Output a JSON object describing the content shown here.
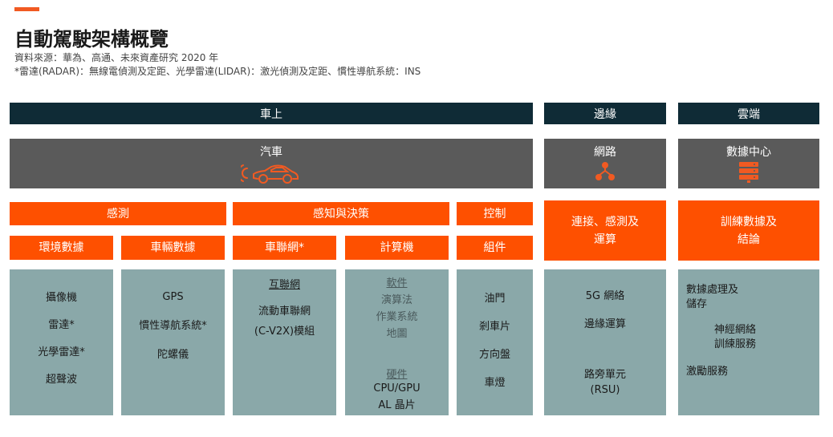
{
  "header": {
    "title": "自動駕駛架構概覽",
    "source": "資料來源：華為、高通、未來資產研究 2020 年",
    "note": "*雷達(RADAR)：無線電偵測及定距、光學雷達(LIDAR)：激光偵測及定距、慣性導航系統：INS"
  },
  "columns": {
    "onboard": "車上",
    "edge": "邊緣",
    "cloud": "雲端"
  },
  "platforms": {
    "car": {
      "label": "汽車",
      "icon": "car-icon"
    },
    "network": {
      "label": "網路",
      "icon": "network-icon"
    },
    "datacenter": {
      "label": "數據中心",
      "icon": "server-icon"
    }
  },
  "categories": {
    "sensing": "感測",
    "perception": "感知與決策",
    "control": "控制",
    "edge": "連接、感測及\n運算",
    "cloud": "訓練數據及\n結論"
  },
  "subcategories": {
    "env": "環境數據",
    "vehicle": "車輛數據",
    "v2x": "車聯網*",
    "compute": "計算機",
    "parts": "組件"
  },
  "details": {
    "env": [
      "攝像機",
      "雷達*",
      "光學雷達*",
      "超聲波"
    ],
    "vehicle": [
      "GPS",
      "慣性導航系統*",
      "陀螺儀"
    ],
    "v2x": {
      "heading": "互聯網",
      "items": [
        "流動車聯網",
        "(C-V2X)模組"
      ]
    },
    "compute": {
      "software_heading": "軟件",
      "software": [
        "演算法",
        "作業系統",
        "地圖"
      ],
      "hardware_heading": "硬件",
      "hardware": [
        "CPU/GPU",
        "AL 晶片"
      ]
    },
    "parts": [
      "油門",
      "剎車片",
      "方向盤",
      "車燈"
    ],
    "edge": [
      "5G 網絡",
      "邊緣運算",
      "路旁單元",
      "(RSU)"
    ],
    "cloud": [
      "數據處理及",
      "儲存",
      "神經網絡",
      "訓練服務",
      "激勵服務"
    ]
  },
  "colors": {
    "accent": "#f15a22",
    "orange": "#fe5000",
    "navy": "#0f2b36",
    "grey": "#5a5a5a",
    "teal": "#8aa8a9"
  }
}
